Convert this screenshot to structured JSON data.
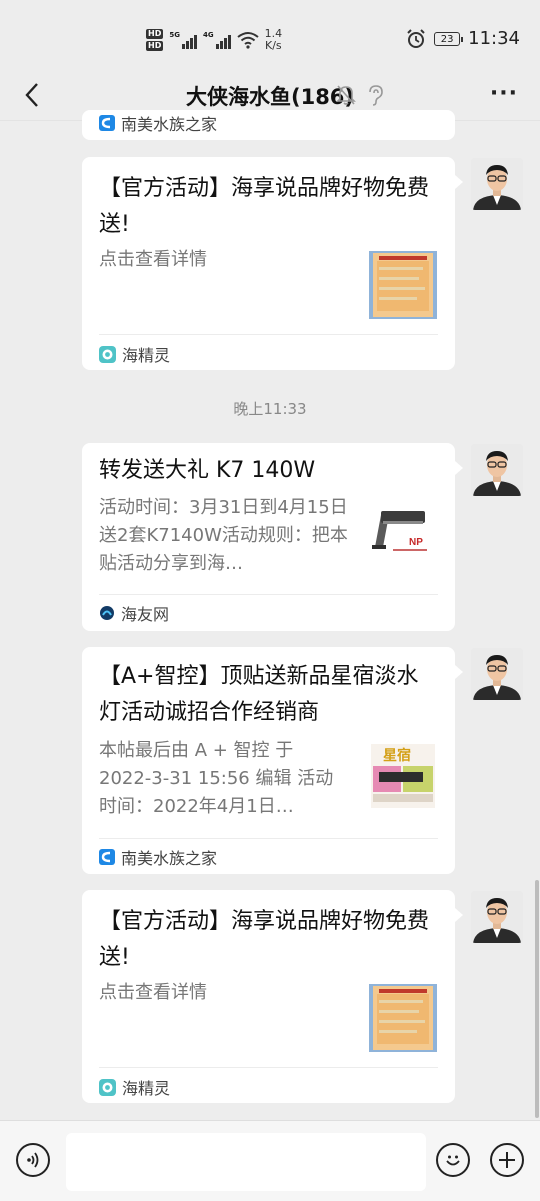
{
  "status_bar": {
    "hd1": "HD",
    "hd2": "HD",
    "sig1_label": "5G",
    "sig2_label": "4G",
    "speed_value": "1.4",
    "speed_unit": "K/s",
    "battery": "23",
    "time": "11:34"
  },
  "header": {
    "title": "大侠海水鱼(186)",
    "more": "···"
  },
  "messages": [
    {
      "title": "",
      "source": "南美水族之家"
    },
    {
      "title": "【官方活动】海享说品牌好物免费送!",
      "desc": "点击查看详情",
      "source": "海精灵"
    },
    {
      "title": "转发送大礼 K7 140W",
      "desc": "活动时间：3月31日到4月15日送2套K7140W活动规则：把本贴活动分享到海…",
      "source": "海友网"
    },
    {
      "title": "【A+智控】顶贴送新品星宿淡水灯活动诚招合作经销商",
      "desc": " 本帖最后由 A + 智控 于 2022-3-31 15:56 编辑 活动时间：2022年4月1日…",
      "source": "南美水族之家"
    },
    {
      "title": "【官方活动】海享说品牌好物免费送!",
      "desc": "点击查看详情",
      "source": "海精灵"
    }
  ],
  "timestamp": "晚上11:33",
  "input": {
    "placeholder": ""
  },
  "colors": {
    "background": "#ededed",
    "card": "#ffffff",
    "source_blue": "#1e88e5",
    "source_teal": "#26a69a"
  }
}
